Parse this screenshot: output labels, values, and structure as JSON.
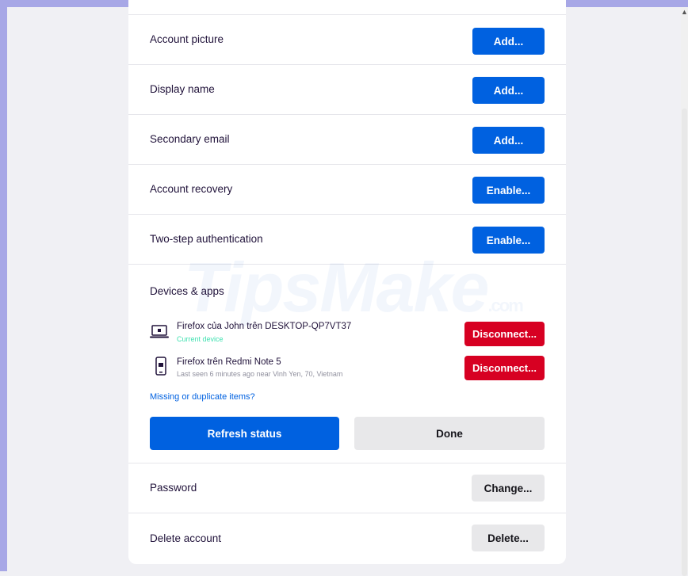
{
  "rows": {
    "account_picture": {
      "label": "Account picture",
      "button": "Add..."
    },
    "display_name": {
      "label": "Display name",
      "button": "Add..."
    },
    "secondary_email": {
      "label": "Secondary email",
      "button": "Add..."
    },
    "account_recovery": {
      "label": "Account recovery",
      "button": "Enable..."
    },
    "two_step": {
      "label": "Two-step authentication",
      "button": "Enable..."
    },
    "password": {
      "label": "Password",
      "button": "Change..."
    },
    "delete_account": {
      "label": "Delete account",
      "button": "Delete..."
    }
  },
  "devices": {
    "title": "Devices & apps",
    "items": [
      {
        "name": "Firefox của John trên DESKTOP-QP7VT37",
        "status": "Current device",
        "status_color": "#3fe1b0",
        "icon": "laptop-icon",
        "button": "Disconnect..."
      },
      {
        "name": "Firefox trên Redmi Note 5",
        "status": "Last seen 6 minutes ago near Vinh Yen, 70, Vietnam",
        "status_color": "#8f8f9d",
        "icon": "phone-icon",
        "button": "Disconnect..."
      }
    ],
    "missing_link": "Missing or duplicate items?",
    "refresh_button": "Refresh status",
    "done_button": "Done"
  },
  "watermark": {
    "text": "TipsMake",
    "suffix": ".com"
  },
  "colors": {
    "primary": "#0061e0",
    "danger": "#d70022",
    "neutral": "#e8e8ea"
  }
}
